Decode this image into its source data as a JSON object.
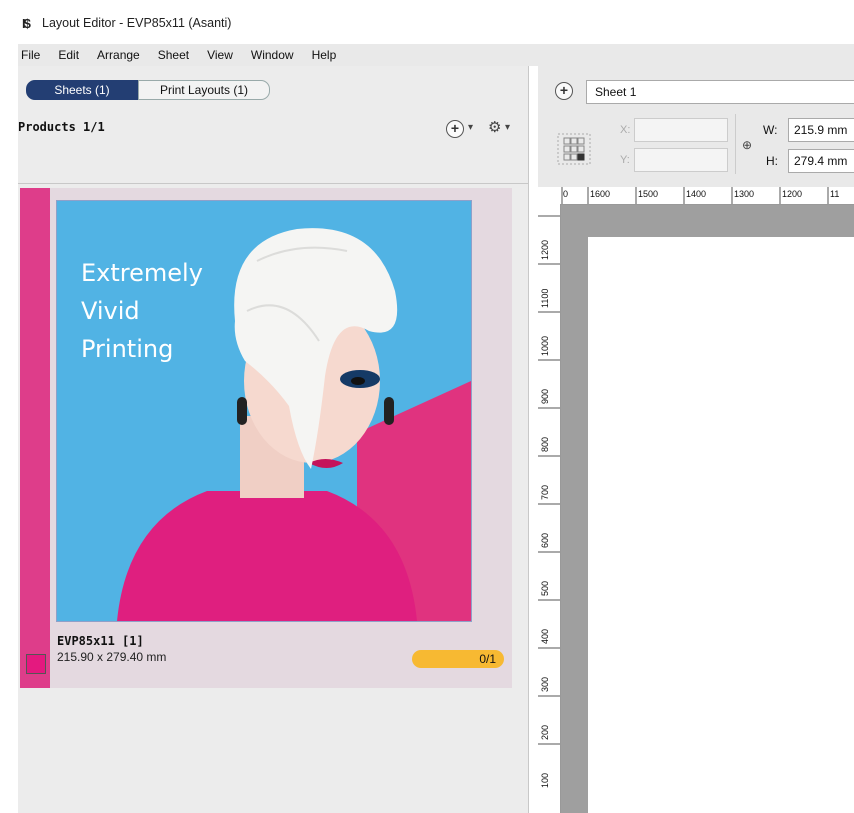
{
  "window": {
    "title": "Layout Editor - EVP85x11 (Asanti)"
  },
  "menu": [
    "File",
    "Edit",
    "Arrange",
    "Sheet",
    "View",
    "Window",
    "Help"
  ],
  "left_panel": {
    "tabs": [
      {
        "label": "Sheets (1)",
        "active": true
      },
      {
        "label": "Print Layouts (1)",
        "active": false
      }
    ],
    "section_title": "Products 1/1",
    "product": {
      "artwork_text": [
        "Extremely",
        "Vivid",
        "Printing"
      ],
      "name": "EVP85x11 [1]",
      "size": "215.90 x 279.40 mm",
      "count": "0/1",
      "swatch_color": "#e4197f"
    }
  },
  "right_panel": {
    "sheet_name": "Sheet 1",
    "x_label": "X:",
    "y_label": "Y:",
    "w_label": "W:",
    "h_label": "H:",
    "w_value": "215.9 mm",
    "h_value": "279.4 mm",
    "ruler_top": [
      "0",
      "1600",
      "1500",
      "1400",
      "1300",
      "1200",
      "11"
    ],
    "ruler_left": [
      "1200",
      "1100",
      "1000",
      "900",
      "800",
      "700",
      "600",
      "500",
      "400",
      "300",
      "200",
      "100"
    ]
  },
  "colors": {
    "accent": "#233e73",
    "magenta": "#de3d8a",
    "sky": "#51b3e4",
    "progress": "#f7b932"
  }
}
